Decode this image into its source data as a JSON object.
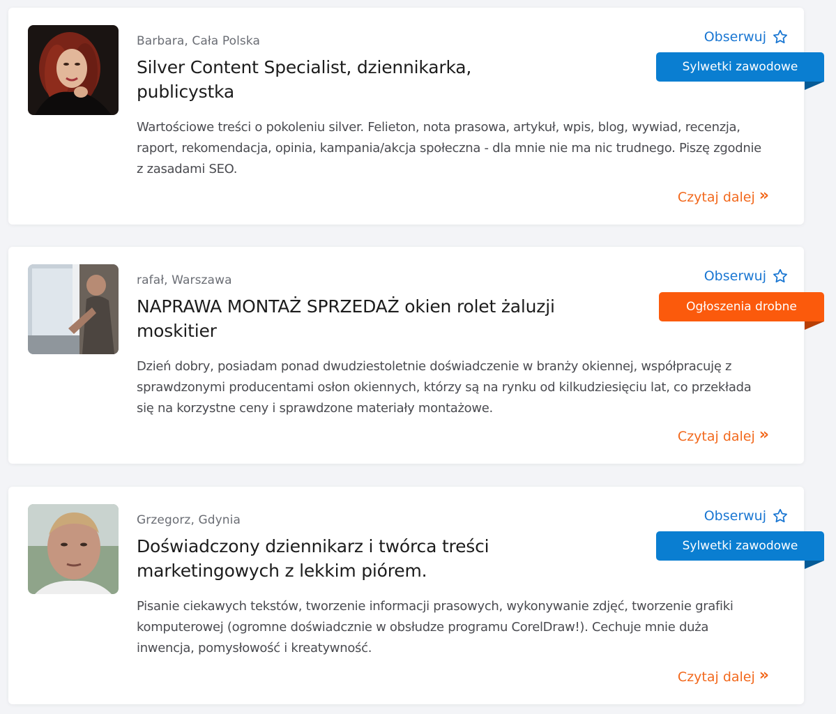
{
  "colors": {
    "accent_blue": "#1976d2",
    "badge_blue": "#0a7ed1",
    "badge_orange": "#fb5a0c",
    "read_more": "#f2681c",
    "background": "#f3f4f7"
  },
  "listings": [
    {
      "meta": "Barbara, Cała Polska",
      "title": "Silver Content Specialist, dziennikarka, publicystka",
      "description": "Wartościowe treści o pokoleniu silver. Felieton, nota prasowa, artykuł, wpis, blog, wywiad, recenzja, raport, rekomendacja, opinia, kampania/akcja społeczna - dla mnie nie ma nic trudnego. Piszę zgodnie z zasadami SEO.",
      "follow_label": "Obserwuj",
      "badge": "Sylwetki zawodowe",
      "badge_color": "blue",
      "read_more": "Czytaj dalej",
      "avatar": "woman-portrait-avatar"
    },
    {
      "meta": "rafał, Warszawa",
      "title": "NAPRAWA MONTAŻ SPRZEDAŻ okien rolet żaluzji moskitier",
      "description": "Dzień dobry, posiadam ponad dwudziestoletnie doświadczenie w branży okiennej, współpracuję z sprawdzonymi producentami osłon okiennych, którzy są na rynku od kilkudziesięciu lat, co przekłada się na korzystne ceny i sprawdzone materiały montażowe.",
      "follow_label": "Obserwuj",
      "badge": "Ogłoszenia drobne",
      "badge_color": "orange",
      "read_more": "Czytaj dalej",
      "avatar": "window-installer-photo"
    },
    {
      "meta": "Grzegorz, Gdynia",
      "title": "Doświadczony dziennikarz i twórca treści marketingowych z lekkim piórem.",
      "description": "Pisanie ciekawych tekstów, tworzenie informacji prasowych, wykonywanie zdjęć, tworzenie grafiki komputerowej (ogromne doświadcznie w obsłudze programu CorelDraw!). Cechuje mnie duża inwencja, pomysłowość i kreatywność.",
      "follow_label": "Obserwuj",
      "badge": "Sylwetki zawodowe",
      "badge_color": "blue",
      "read_more": "Czytaj dalej",
      "avatar": "man-portrait-avatar"
    }
  ]
}
